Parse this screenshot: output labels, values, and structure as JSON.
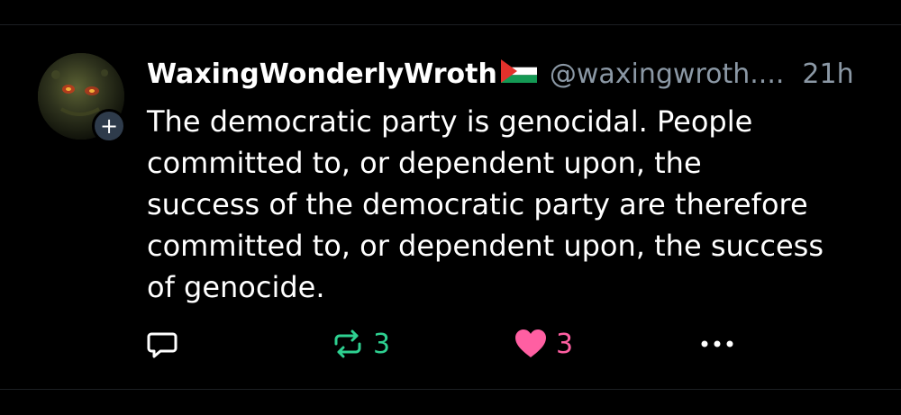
{
  "post": {
    "display_name": "WaxingWonderlyWroth",
    "handle": "@waxingwroth....",
    "timestamp": "21h",
    "text": "The democratic party is genocidal. People\ncommitted to, or dependent upon, the\nsuccess of the democratic party are therefore\ncommitted to, or dependent upon, the success\nof genocide.",
    "flag_icon": "palestine-flag-emoji",
    "avatar": "avatar-image",
    "follow_badge": "+"
  },
  "actions": {
    "reply": {
      "icon": "reply-icon"
    },
    "repost": {
      "icon": "repost-icon",
      "count": "3",
      "color": "#2ed191"
    },
    "like": {
      "icon": "heart-icon",
      "count": "3",
      "color": "#ff5fa2"
    },
    "more": {
      "icon": "more-icon"
    }
  },
  "colors": {
    "background": "#000000",
    "text": "#ffffff",
    "muted": "#8b98a5"
  }
}
